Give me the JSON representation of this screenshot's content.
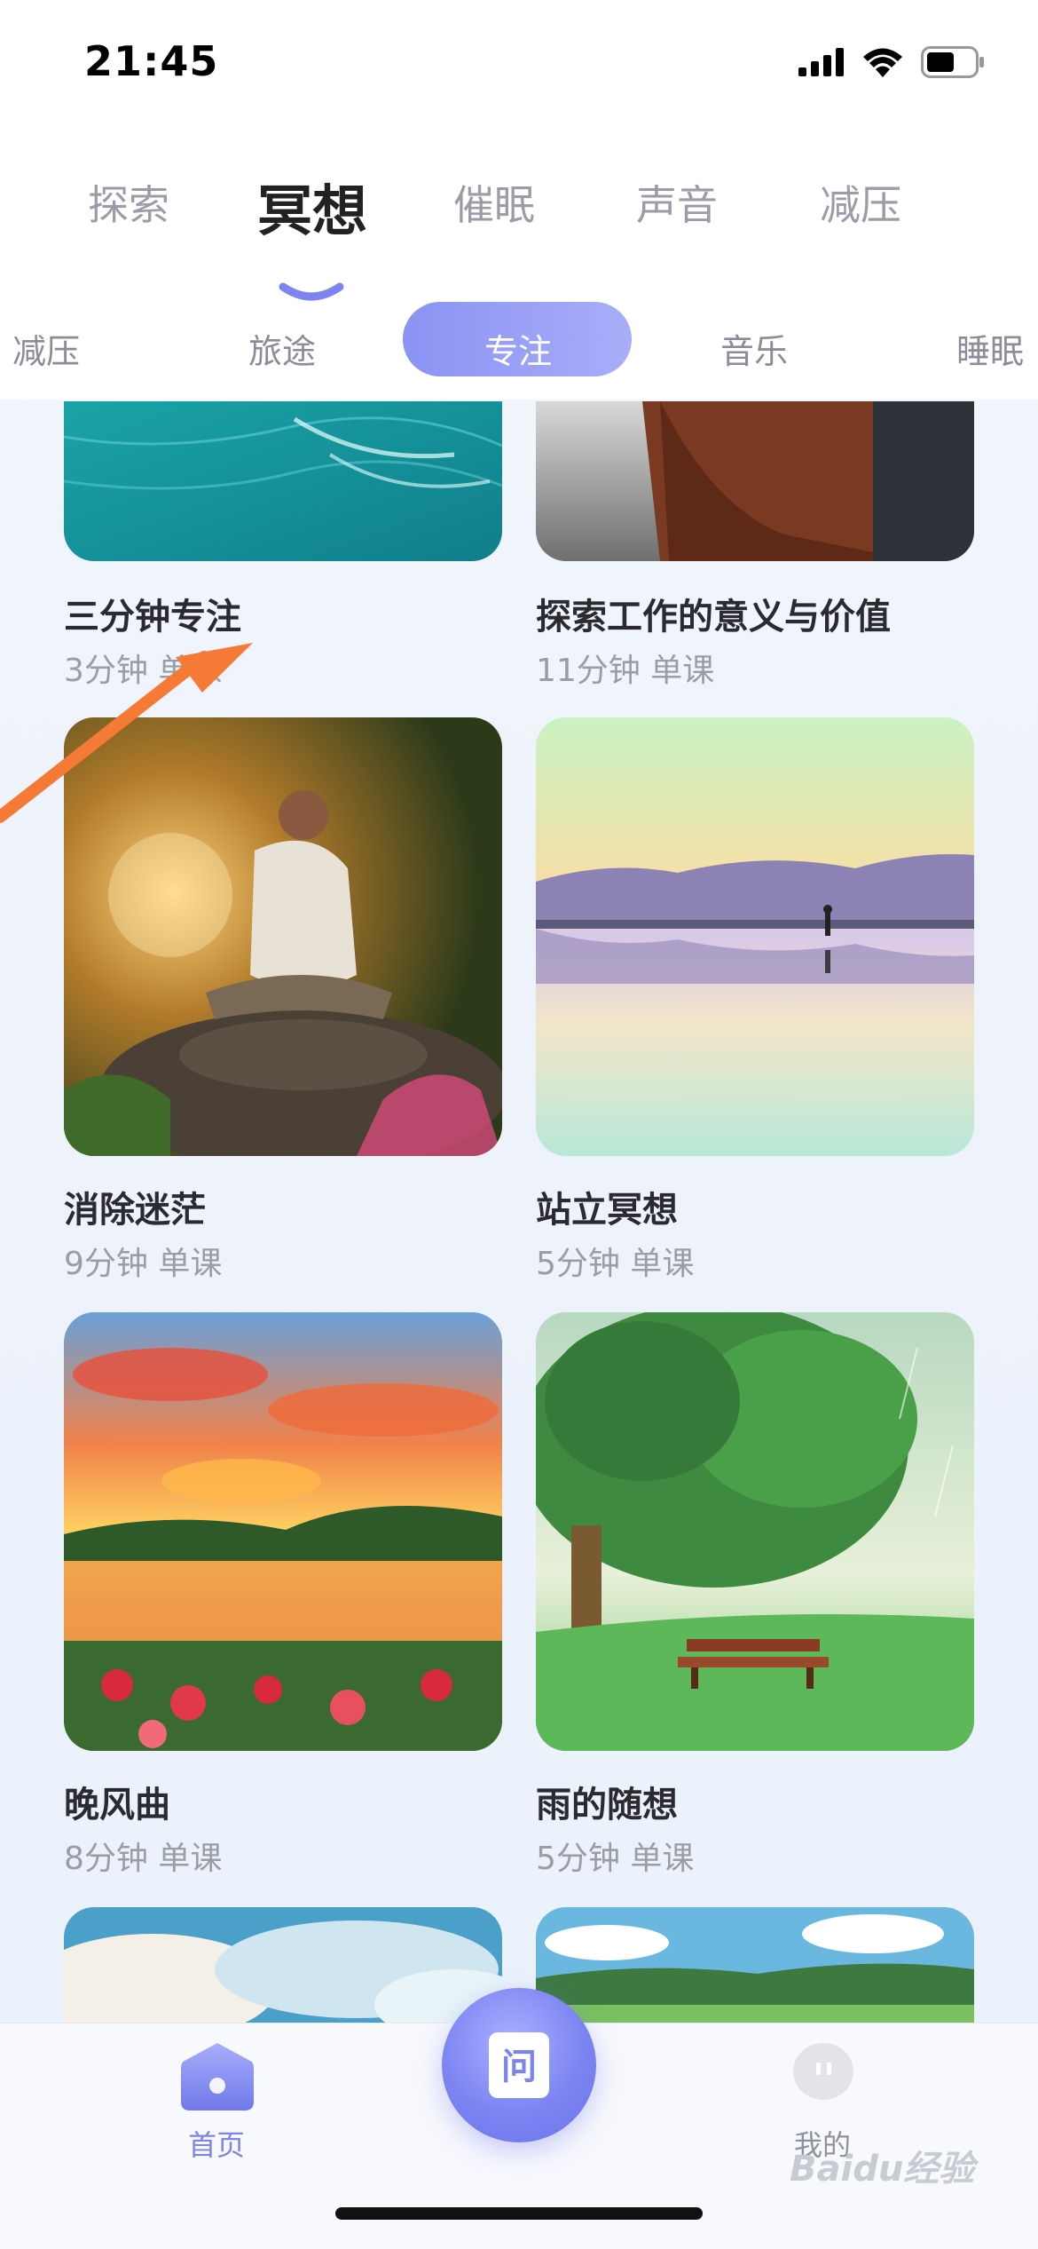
{
  "status": {
    "time": "21:45"
  },
  "main_tabs": [
    {
      "label": "探索",
      "active": false
    },
    {
      "label": "冥想",
      "active": true
    },
    {
      "label": "催眠",
      "active": false
    },
    {
      "label": "声音",
      "active": false
    },
    {
      "label": "减压",
      "active": false
    }
  ],
  "sub_tabs": [
    {
      "label": "减压",
      "active": false
    },
    {
      "label": "旅途",
      "active": false
    },
    {
      "label": "专注",
      "active": true
    },
    {
      "label": "音乐",
      "active": false
    },
    {
      "label": "睡眠",
      "active": false
    }
  ],
  "cards": [
    {
      "title": "三分钟专注",
      "meta": "3分钟 单课"
    },
    {
      "title": "探索工作的意义与价值",
      "meta": "11分钟 单课"
    },
    {
      "title": "消除迷茫",
      "meta": "9分钟 单课"
    },
    {
      "title": "站立冥想",
      "meta": "5分钟 单课"
    },
    {
      "title": "晚风曲",
      "meta": "8分钟 单课"
    },
    {
      "title": "雨的随想",
      "meta": "5分钟 单课"
    }
  ],
  "bottom_nav": {
    "home_label": "首页",
    "center_label": "问",
    "me_label": "我的"
  },
  "watermark": "Baidu经验",
  "colors": {
    "accent": "#7c84f2",
    "pill_start": "#8a93f4",
    "pill_end": "#a8aef8",
    "arrow": "#f47a35"
  }
}
